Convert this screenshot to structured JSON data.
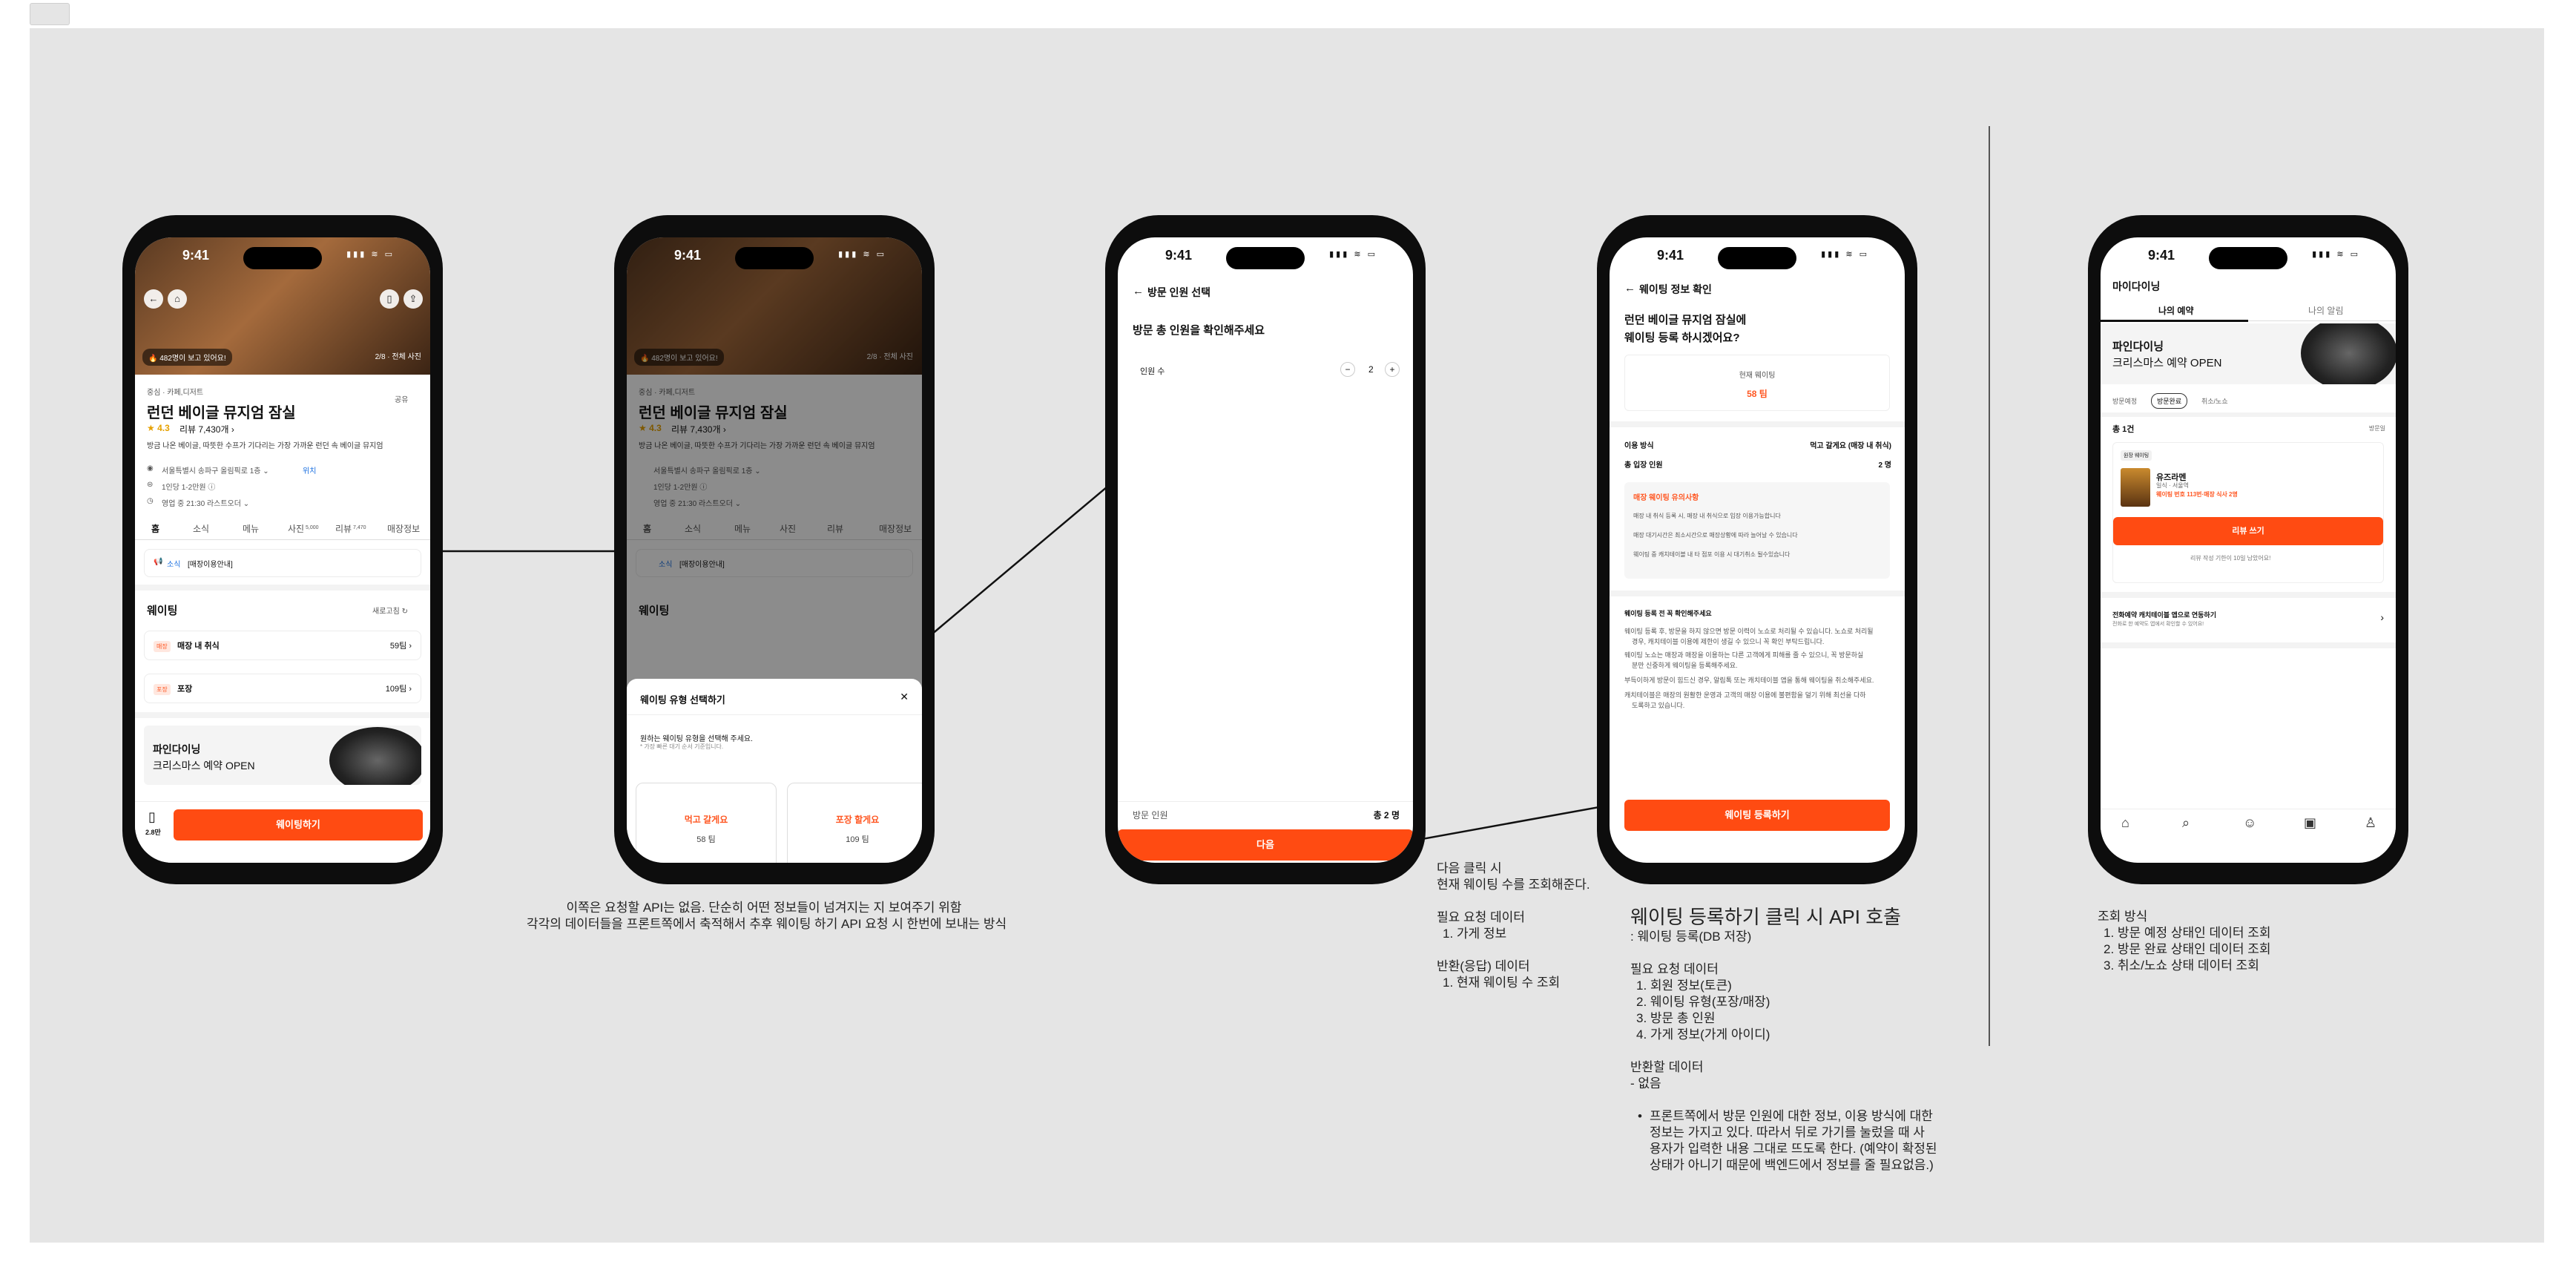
{
  "status_time": "9:41",
  "status_icons": "▮▮▮ ≋ ▭",
  "p1": {
    "hero_badge": "🔥 482명이 보고 있어요!",
    "hero_count": "2/8 · 전체 사진",
    "category": "중심 · 카페,디저트",
    "share": "공유",
    "name": "런던 베이글 뮤지엄 잠실",
    "rating": "★ 4.3",
    "reviews": "리뷰 7,430개 ›",
    "desc": "방금 나온 베이글, 따뜻한 수프가 기다리는 가장 가까운 런던 속 베이글 뮤지엄",
    "address": "서울특별시 송파구 올림픽로 1층 ⌄",
    "location": "위치",
    "price": "1인당  1-2만원 ⓘ",
    "hours": "영업 중  21:30 라스트오더 ⌄",
    "tabs": [
      "홈",
      "소식",
      "메뉴",
      "사진",
      "리뷰",
      "매장정보"
    ],
    "tab_counts": [
      "",
      "",
      "",
      "5,000",
      "7,470",
      ""
    ],
    "notice_tag": "소식",
    "notice": "[매장이용안내]",
    "waiting_title": "웨이팅",
    "refresh": "새로고침 ↻",
    "rows": [
      {
        "tag": "매장",
        "label": "매장 내 취식",
        "count": "59팀 ›"
      },
      {
        "tag": "포장",
        "label": "포장",
        "count": "109팀 ›"
      }
    ],
    "promo_brand": "파인다이닝",
    "promo_text": "크리스마스 예약 OPEN",
    "bookmark": "2.8만",
    "cta": "웨이팅하기"
  },
  "p2": {
    "sheet_title": "웨이팅 유형 선택하기",
    "close": "✕",
    "sheet_desc": "원하는 웨이팅 유형을 선택해 주세요.",
    "sheet_sub": "* 가장 빠른 대기 순서 기준입니다.",
    "opt1_label": "먹고 갈게요",
    "opt1_count": "58 팀",
    "opt2_label": "포장 할게요",
    "opt2_count": "109 팀"
  },
  "p3": {
    "back_title": "방문 인원 선택",
    "headline": "방문 총 인원을 확인해주세요",
    "count_label": "인원 수",
    "minus": "−",
    "count": "2",
    "plus": "+",
    "footer_label": "방문 인원",
    "footer_total": "총 2 명",
    "cta": "다음"
  },
  "p4": {
    "back_title": "웨이팅 정보 확인",
    "headline1": "런던 베이글 뮤지엄 잠실에",
    "headline2": "웨이팅 등록 하시겠어요?",
    "current_label": "현재 웨이팅",
    "current_value": "58 팀",
    "usage_label": "이용 방식",
    "usage_value": "먹고 갈게요 (매장 내 취식)",
    "people_label": "총 입장 인원",
    "people_value": "2 명",
    "warn_title": "매장 웨이팅 유의사항",
    "warns": [
      "매장 내 취식 등록 시, 매장 내 취식으로 입장 이용가능합니다",
      "매장 대기시간은 최소시간으로 매장상황에 따라 늘어날 수 있습니다",
      "웨이팅 중 캐치테이블 내 타 점포 이용 시 대기취소 될수있습니다"
    ],
    "check_title": "웨이팅 등록 전 꼭 확인해주세요",
    "checks": [
      "웨이팅 등록 후, 방문을 하지 않으면 방문 이력이 노쇼로 처리될 수 있습니다. 노쇼로 처리될",
      "경우, 캐치테이블 이용에 제한이 생길 수 있으니 꼭 확인 부탁드립니다.",
      "웨이팅 노쇼는 매장과 매장을 이용하는 다른 고객에게 피해를 줄 수 있으니, 꼭 방문하실",
      "분만 신중하게 웨이팅을 등록해주세요.",
      "부득이하게 방문이 힘드신 경우, 알림톡 또는 캐치테이블 앱을 통해 웨이팅을 취소해주세요.",
      "캐치테이블은 매장의 원활한 운영과 고객의 매장 이용에 불편함을 덜기 위해 최선을 다하",
      "도록하고 있습니다."
    ],
    "cta": "웨이팅 등록하기"
  },
  "p5": {
    "title": "마이다이닝",
    "tab1": "나의 예약",
    "tab2": "나의 알림",
    "banner_brand": "파인다이닝",
    "banner_text": "크리스마스 예약 OPEN",
    "chips": [
      "방문예정",
      "방문완료",
      "취소/노쇼"
    ],
    "total": "총 1건",
    "sort": "방문일",
    "card_tag": "원장 웨이팅",
    "card_name": "유즈라멘",
    "card_sub": "일식 · 서울역",
    "card_info": "웨이팅 번호 113번·매장 식사 2명",
    "review_btn": "리뷰 쓰기",
    "review_hint": "리뷰 작성 기한이 10일 남았어요!",
    "link_title": "전화예약 캐치테이블 앱으로 연동하기",
    "link_sub": "전화로 한 예약도 앱에서 확인할 수 있어요!",
    "nav": [
      "⌂",
      "⌕",
      "☺",
      "▣",
      "♙"
    ]
  },
  "notes": {
    "n1": [
      "이쪽은 요청할 API는 없음. 단순히 어떤 정보들이 넘겨지는 지 보여주기 위함",
      "각각의 데이터들을 프론트쪽에서 축적해서 추후 웨이팅 하기 API 요청 시 한번에 보내는 방식"
    ],
    "n3": [
      "다음 클릭 시",
      "현재 웨이팅 수를 조회해준다.",
      "",
      "필요 요청 데이터",
      "  1. 가게 정보",
      "",
      "반환(응답) 데이터",
      "  1. 현재 웨이팅 수 조회"
    ],
    "n4_title": "웨이팅 등록하기 클릭 시 API 호출",
    "n4": [
      ": 웨이팅 등록(DB 저장)",
      "",
      "필요 요청 데이터",
      "  1. 회원 정보(토큰)",
      "  2. 웨이팅 유형(포장/매장)",
      "  3. 방문 총 인원",
      "  4. 가게 정보(가게 아이디)",
      "",
      "반환할 데이터",
      "- 없음"
    ],
    "n4_bullet": [
      "프론트쪽에서 방문 인원에 대한 정보, 이용 방식에 대한",
      "정보는 가지고 있다. 따라서 뒤로 가기를 눌렀을 때 사",
      "용자가 입력한 내용 그대로 뜨도록 한다. (예약이 확정된",
      "상태가 아니기 때문에 백엔드에서 정보를 줄 필요없음.)"
    ],
    "n5": [
      "조회 방식",
      "  1. 방문 예정 상태인 데이터 조회",
      "  2. 방문 완료 상태인 데이터 조회",
      "  3. 취소/노쇼 상태 데이터 조회"
    ]
  }
}
